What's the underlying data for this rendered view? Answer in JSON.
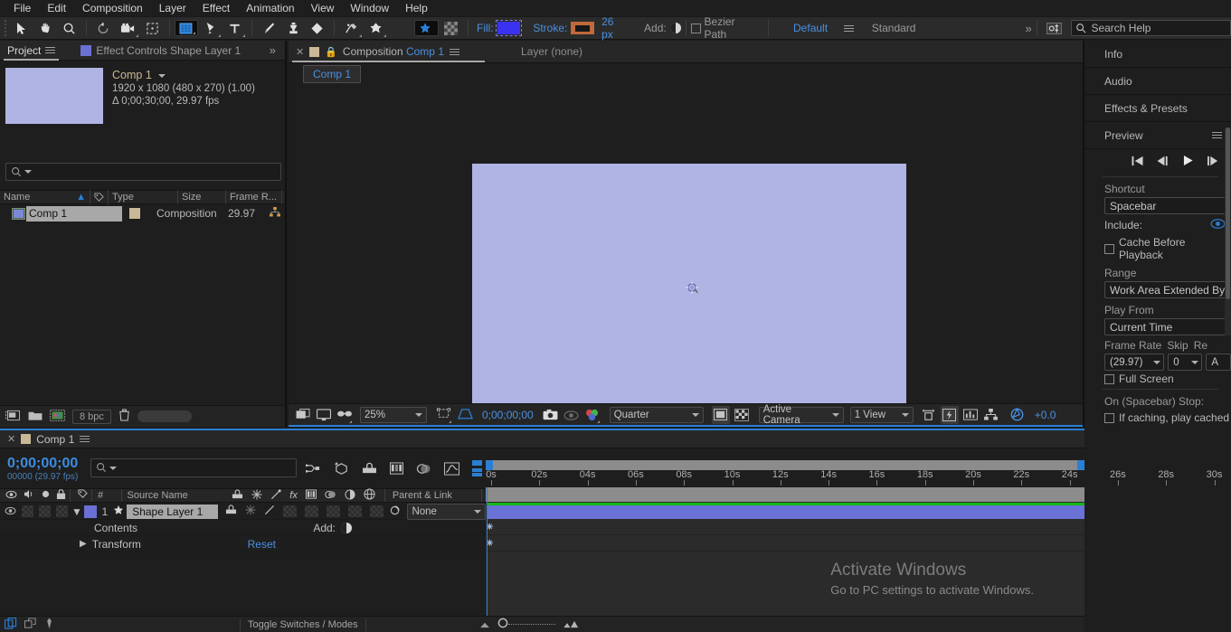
{
  "menu": {
    "items": [
      "File",
      "Edit",
      "Composition",
      "Layer",
      "Effect",
      "Animation",
      "View",
      "Window",
      "Help"
    ]
  },
  "toolbar": {
    "fill_label": "Fill:",
    "stroke_label": "Stroke:",
    "stroke_width": "26 px",
    "add_label": "Add:",
    "bezier_label": "Bezier Path",
    "workspace_default": "Default",
    "workspace_standard": "Standard",
    "overflow": "»",
    "search_placeholder": "Search Help",
    "fill_color": "#3b31f0",
    "stroke_color": "#c0693c"
  },
  "project": {
    "tabs": [
      {
        "label": "Project",
        "active": true
      },
      {
        "label": "Effect Controls Shape Layer 1",
        "active": false
      }
    ],
    "overflow": "»",
    "comp_name": "Comp 1",
    "resolution": "1920 x 1080  (480 x 270) (1.00)",
    "duration": "Δ 0;00;30;00, 29.97 fps",
    "search_placeholder": "",
    "columns": [
      "Name",
      "Type",
      "Size",
      "Frame R..."
    ],
    "rows": [
      {
        "name": "Comp 1",
        "type": "Composition",
        "size": "",
        "frame_rate": "29.97"
      }
    ],
    "bit_depth": "8 bpc"
  },
  "composition": {
    "tab_prefix": "Composition",
    "tab_name": "Comp 1",
    "layer_label": "Layer  (none)",
    "breadcrumb": "Comp 1",
    "canvas_color": "#b0b4e4",
    "footer": {
      "zoom": "25%",
      "timecode": "0;00;00;00",
      "resolution": "Quarter",
      "camera": "Active Camera",
      "views": "1 View",
      "exposure": "+0.0"
    }
  },
  "right_panel": {
    "sections": [
      "Info",
      "Audio",
      "Effects & Presets"
    ],
    "preview": {
      "title": "Preview",
      "shortcut_label": "Shortcut",
      "shortcut_value": "Spacebar",
      "include_label": "Include:",
      "cache_label": "Cache Before Playback",
      "range_label": "Range",
      "range_value": "Work Area Extended By C",
      "play_from_label": "Play From",
      "play_from_value": "Current Time",
      "frame_rate_label": "Frame Rate",
      "frame_rate_value": "(29.97)",
      "skip_label": "Skip",
      "skip_value": "0",
      "resolution_label": "Re",
      "resolution_value": "A",
      "full_screen_label": "Full Screen",
      "on_stop_label": "On (Spacebar) Stop:",
      "if_caching_label": "If caching, play cached"
    }
  },
  "timeline": {
    "tab_name": "Comp 1",
    "current_time": "0;00;00;00",
    "frame_info": "00000 (29.97 fps)",
    "search_placeholder": "",
    "columns": [
      "#",
      "Source Name",
      "Parent & Link"
    ],
    "layers": [
      {
        "index": "1",
        "name": "Shape Layer 1",
        "parent": "None",
        "properties": [
          {
            "label": "Contents",
            "action": "Add:"
          },
          {
            "label": "Transform",
            "action": "Reset"
          }
        ]
      }
    ],
    "ruler_labels": [
      "0s",
      "02s",
      "04s",
      "06s",
      "08s",
      "10s",
      "12s",
      "14s",
      "16s",
      "18s",
      "20s",
      "22s",
      "24s",
      "26s",
      "28s",
      "30s"
    ],
    "toggle_switches": "Toggle Switches / Modes"
  },
  "watermark": {
    "title": "Activate Windows",
    "subtitle": "Go to PC settings to activate Windows."
  }
}
